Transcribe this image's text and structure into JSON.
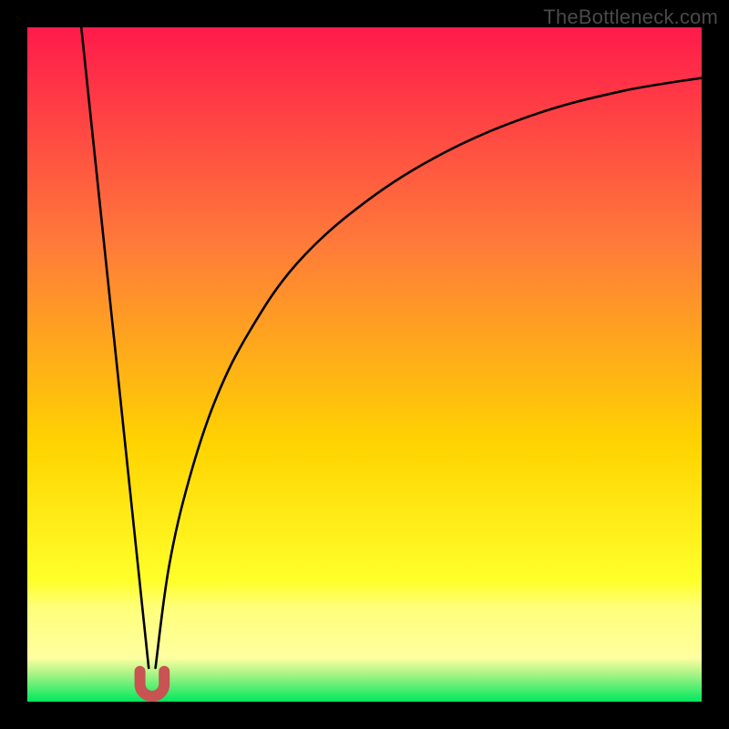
{
  "watermark": "TheBottleneck.com",
  "colors": {
    "frame": "#000000",
    "gradient_top": "#ff1a4b",
    "gradient_mid1": "#ff7a3a",
    "gradient_mid2": "#ffd400",
    "gradient_band": "#ffff7a",
    "gradient_bottom": "#00e85e",
    "curve": "#000000",
    "marker": "#c95252"
  },
  "chart_data": {
    "type": "line",
    "title": "",
    "xlabel": "",
    "ylabel": "",
    "x_range": [
      0,
      100
    ],
    "y_range": [
      0,
      100
    ],
    "x_tip": 18.5,
    "curves": [
      {
        "name": "left-branch",
        "description": "steep near-linear descent from top-left corner to the tip",
        "points": [
          {
            "x": 8.0,
            "y": 100.0
          },
          {
            "x": 10.0,
            "y": 81.0
          },
          {
            "x": 12.0,
            "y": 62.0
          },
          {
            "x": 14.0,
            "y": 43.0
          },
          {
            "x": 16.0,
            "y": 24.0
          },
          {
            "x": 17.0,
            "y": 14.5
          },
          {
            "x": 18.0,
            "y": 5.0
          }
        ]
      },
      {
        "name": "right-branch",
        "description": "rises from the tip and asymptotically approaches the top-right",
        "points": [
          {
            "x": 19.0,
            "y": 5.0
          },
          {
            "x": 21.0,
            "y": 20.0
          },
          {
            "x": 24.0,
            "y": 33.0
          },
          {
            "x": 28.0,
            "y": 45.0
          },
          {
            "x": 33.0,
            "y": 55.0
          },
          {
            "x": 40.0,
            "y": 65.0
          },
          {
            "x": 50.0,
            "y": 74.0
          },
          {
            "x": 62.0,
            "y": 81.5
          },
          {
            "x": 75.0,
            "y": 87.0
          },
          {
            "x": 88.0,
            "y": 90.5
          },
          {
            "x": 100.0,
            "y": 92.5
          }
        ]
      }
    ],
    "marker": {
      "name": "tip-marker",
      "shape": "u-shape",
      "cx": 18.5,
      "width": 3.6,
      "y_top": 4.5,
      "y_bottom": 0.8,
      "stroke_width_px": 12
    },
    "background_gradient": {
      "stops": [
        {
          "offset": 0.0,
          "color": "#ff1a4b"
        },
        {
          "offset": 0.32,
          "color": "#ff7a3a"
        },
        {
          "offset": 0.62,
          "color": "#ffd400"
        },
        {
          "offset": 0.82,
          "color": "#ffff2a"
        },
        {
          "offset": 0.86,
          "color": "#ffff7a"
        },
        {
          "offset": 0.935,
          "color": "#ffffa0"
        },
        {
          "offset": 0.955,
          "color": "#b8f58a"
        },
        {
          "offset": 1.0,
          "color": "#00e85e"
        }
      ]
    }
  }
}
